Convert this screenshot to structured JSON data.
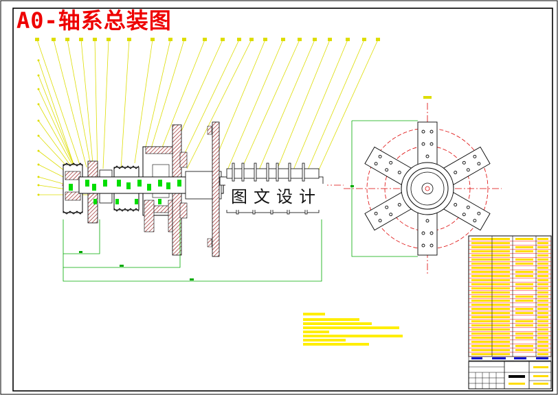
{
  "drawing": {
    "title": "A0-轴系总装图",
    "watermark": "图文设计"
  },
  "colors": {
    "frame": "#000000",
    "title": "#ee0000",
    "leader": "#dddd00",
    "dim": "#00aa00",
    "hatch": "#880000",
    "center": "#dd0000",
    "green_part": "#00dd00",
    "table_fill": "#ffdd00",
    "table_line": "#ff0000",
    "table_blue": "#0000cc"
  }
}
